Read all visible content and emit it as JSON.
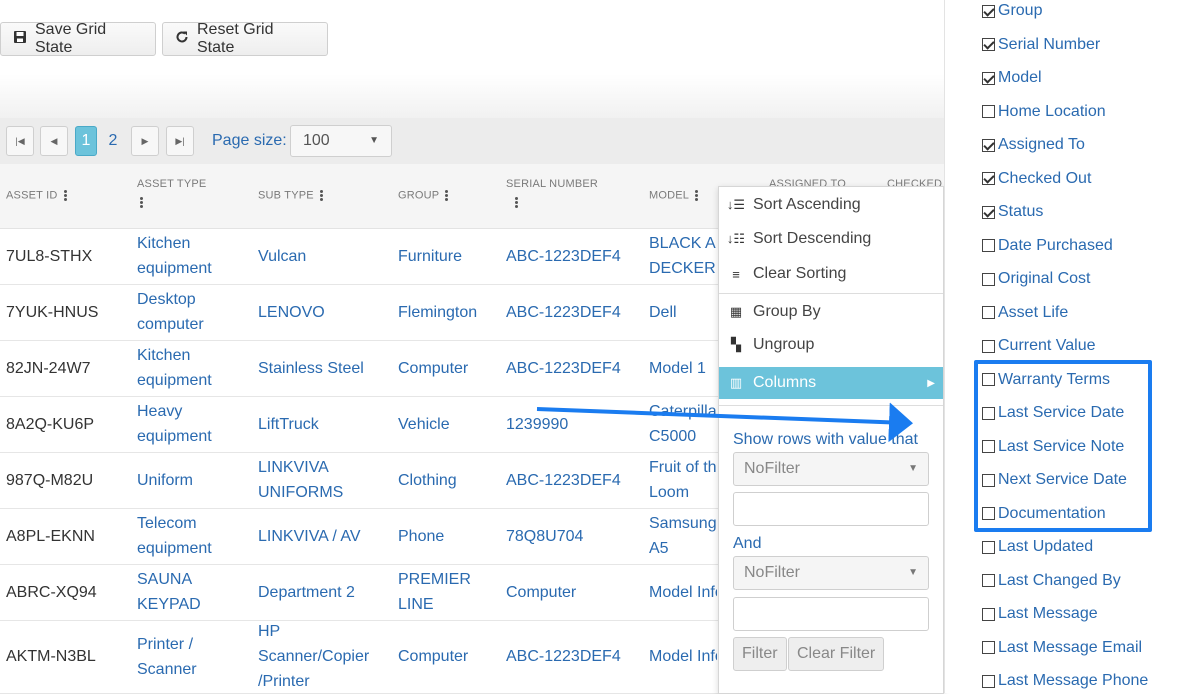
{
  "toolbar": {
    "save_label": "Save Grid State",
    "reset_label": "Reset Grid State"
  },
  "pager": {
    "pages": [
      "1",
      "2"
    ],
    "current_page": "1",
    "page_size_label": "Page size:",
    "page_size_value": "100"
  },
  "columns": [
    "ASSET ID",
    "ASSET TYPE",
    "SUB TYPE",
    "GROUP",
    "SERIAL NUMBER",
    "MODEL",
    "ASSIGNED TO",
    "CHECKED"
  ],
  "rows": [
    {
      "asset_id": "7UL8-STHX",
      "asset_type": [
        "Kitchen",
        "equipment"
      ],
      "sub_type": [
        "Vulcan"
      ],
      "group": [
        "Furniture"
      ],
      "serial": [
        "ABC-1223DEF4"
      ],
      "model": [
        "BLACK A",
        "DECKER"
      ]
    },
    {
      "asset_id": "7YUK-HNUS",
      "asset_type": [
        "Desktop",
        "computer"
      ],
      "sub_type": [
        "LENOVO"
      ],
      "group": [
        "Flemington"
      ],
      "serial": [
        "ABC-1223DEF4"
      ],
      "model": [
        "Dell"
      ]
    },
    {
      "asset_id": "82JN-24W7",
      "asset_type": [
        "Kitchen",
        "equipment"
      ],
      "sub_type": [
        "Stainless Steel"
      ],
      "group": [
        "Computer"
      ],
      "serial": [
        "ABC-1223DEF4"
      ],
      "model": [
        "Model 1"
      ]
    },
    {
      "asset_id": "8A2Q-KU6P",
      "asset_type": [
        "Heavy",
        "equipment"
      ],
      "sub_type": [
        "LiftTruck"
      ],
      "group": [
        "Vehicle"
      ],
      "serial": [
        "1239990"
      ],
      "model": [
        "Caterpilla",
        "C5000"
      ]
    },
    {
      "asset_id": "987Q-M82U",
      "asset_type": [
        "Uniform"
      ],
      "sub_type": [
        "LINKVIVA",
        "UNIFORMS"
      ],
      "group": [
        "Clothing"
      ],
      "serial": [
        "ABC-1223DEF4"
      ],
      "model": [
        "Fruit of th",
        "Loom"
      ]
    },
    {
      "asset_id": "A8PL-EKNN",
      "asset_type": [
        "Telecom",
        "equipment"
      ],
      "sub_type": [
        "LINKVIVA / AV"
      ],
      "group": [
        "Phone"
      ],
      "serial": [
        "78Q8U704"
      ],
      "model": [
        "Samsung",
        "A5"
      ]
    },
    {
      "asset_id": "ABRC-XQ94",
      "asset_type": [
        "SAUNA",
        "KEYPAD"
      ],
      "sub_type": [
        "Department 2"
      ],
      "group": [
        "PREMIER",
        "LINE"
      ],
      "serial": [
        "Computer"
      ],
      "model": [
        "Model Info"
      ]
    },
    {
      "asset_id": "AKTM-N3BL",
      "asset_type": [
        "Printer /",
        "Scanner"
      ],
      "sub_type": [
        "HP",
        "Scanner/Copier",
        "/Printer"
      ],
      "group": [
        "Computer"
      ],
      "serial": [
        "ABC-1223DEF4"
      ],
      "model": [
        "Model Info"
      ]
    }
  ],
  "menu": {
    "items": [
      "Sort Ascending",
      "Sort Descending",
      "Clear Sorting",
      "Group By",
      "Ungroup",
      "Columns"
    ],
    "filter_label": "Show rows with value that",
    "operator1": "NoFilter",
    "and_label": "And",
    "operator2": "NoFilter",
    "filter_button": "Filter",
    "clear_filter_button": "Clear Filter"
  },
  "column_chooser": [
    {
      "label": "Group",
      "checked": true
    },
    {
      "label": "Serial Number",
      "checked": true
    },
    {
      "label": "Model",
      "checked": true
    },
    {
      "label": "Home Location",
      "checked": false
    },
    {
      "label": "Assigned To",
      "checked": true
    },
    {
      "label": "Checked Out",
      "checked": true
    },
    {
      "label": "Status",
      "checked": true
    },
    {
      "label": "Date Purchased",
      "checked": false
    },
    {
      "label": "Original Cost",
      "checked": false
    },
    {
      "label": "Asset Life",
      "checked": false
    },
    {
      "label": "Current Value",
      "checked": false
    },
    {
      "label": "Warranty Terms",
      "checked": false
    },
    {
      "label": "Last Service Date",
      "checked": false
    },
    {
      "label": "Last Service Note",
      "checked": false
    },
    {
      "label": "Next Service Date",
      "checked": false
    },
    {
      "label": "Documentation",
      "checked": false
    },
    {
      "label": "Last Updated",
      "checked": false
    },
    {
      "label": "Last Changed By",
      "checked": false
    },
    {
      "label": "Last Message",
      "checked": false
    },
    {
      "label": "Last Message Email",
      "checked": false
    },
    {
      "label": "Last Message Phone",
      "checked": false
    }
  ],
  "colors": {
    "accent": "#6cc3db",
    "link": "#2a6ab0",
    "annotation": "#1a7cf0"
  }
}
